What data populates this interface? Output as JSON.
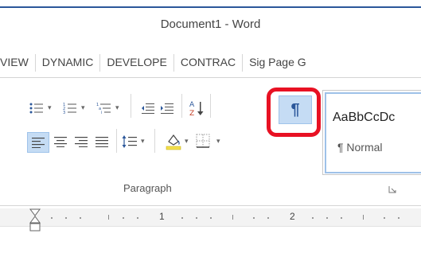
{
  "window": {
    "title": "Document1 - Word"
  },
  "tabs": [
    "VIEW",
    "DYNAMIC",
    "DEVELOPE",
    "CONTRAC",
    "Sig Page G"
  ],
  "paragraph_group": {
    "label": "Paragraph",
    "buttons": {
      "bullets": "bullets-icon",
      "numbering": "numbering-icon",
      "multilevel": "multilevel-list-icon",
      "decrease_indent": "decrease-indent-icon",
      "increase_indent": "increase-indent-icon",
      "sort": "sort-az-icon",
      "show_hide": "¶",
      "align_left": "align-left-icon",
      "center": "align-center-icon",
      "align_right": "align-right-icon",
      "justify": "justify-icon",
      "line_spacing": "line-spacing-icon",
      "shading": "shading-icon",
      "borders": "borders-icon"
    },
    "active": [
      "show_hide",
      "align_left"
    ]
  },
  "styles": {
    "sample": "AaBbCcDc",
    "name": "¶ Normal"
  },
  "ruler": {
    "numbers": [
      "1",
      "2"
    ]
  },
  "colors": {
    "accent": "#2b579a",
    "highlight_ring": "#e81123",
    "active_fill": "#c5dcf4"
  }
}
